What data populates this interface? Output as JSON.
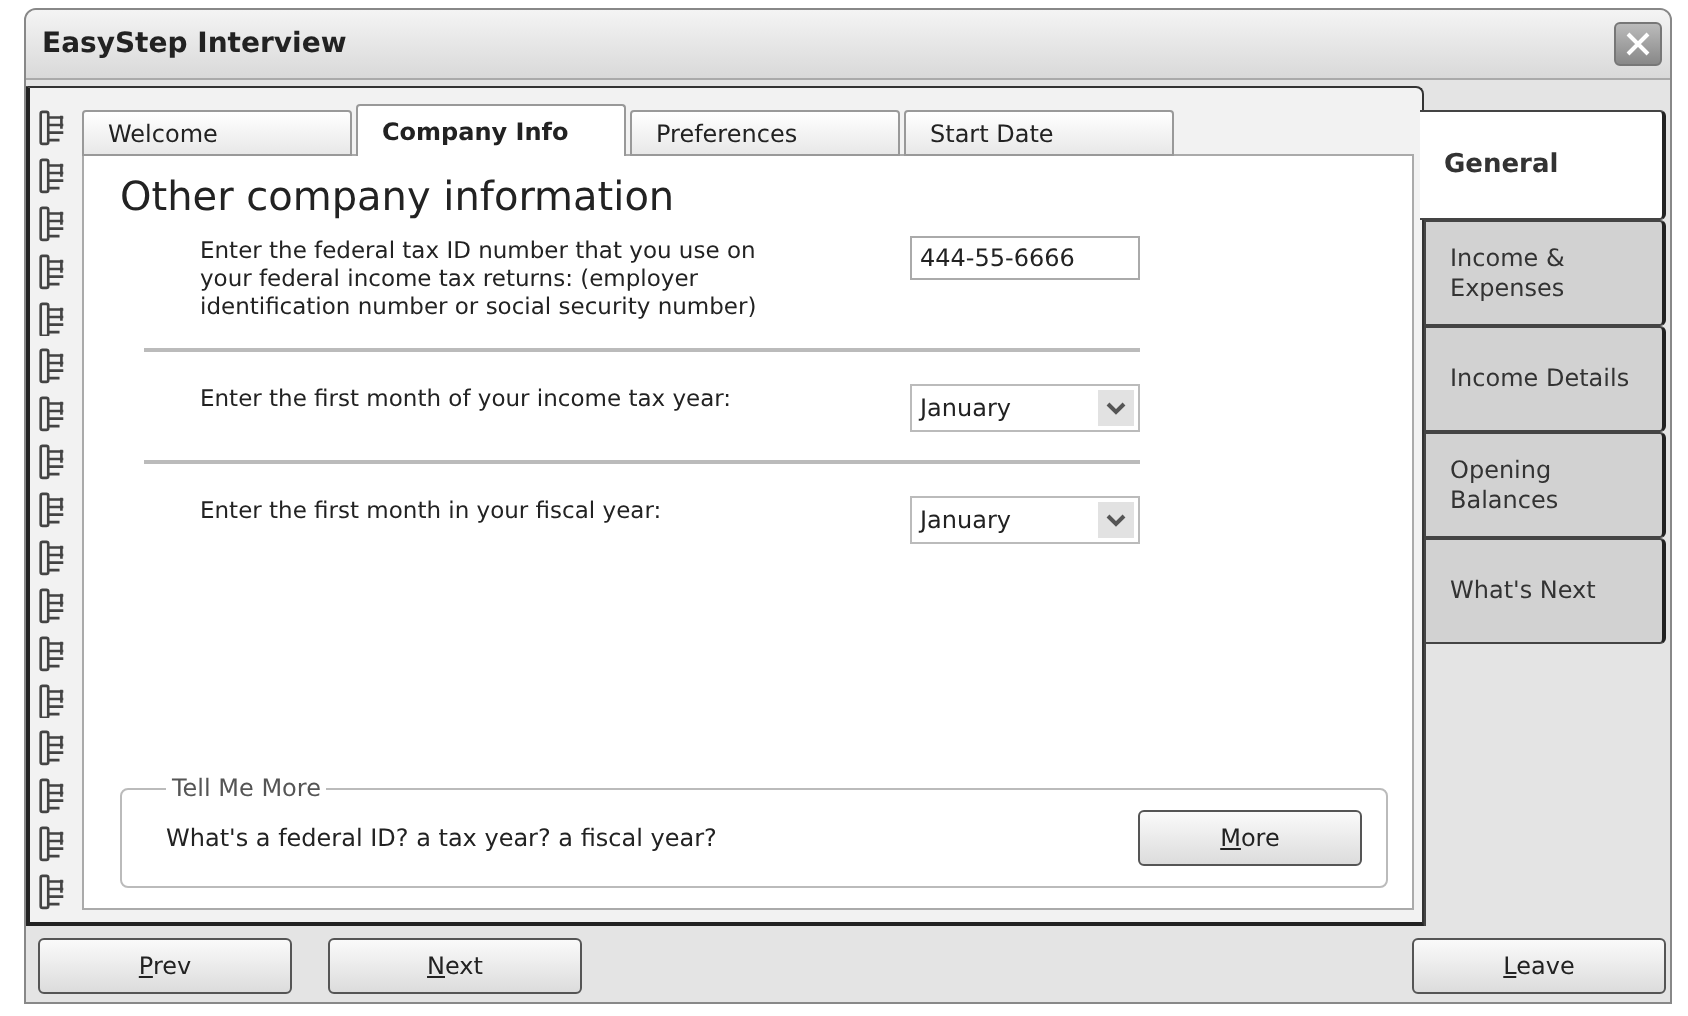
{
  "window": {
    "title": "EasyStep Interview"
  },
  "tabs": [
    {
      "label": "Welcome",
      "selected": false
    },
    {
      "label": "Company Info",
      "selected": true
    },
    {
      "label": "Preferences",
      "selected": false
    },
    {
      "label": "Start Date",
      "selected": false
    }
  ],
  "sections": [
    {
      "label": "General",
      "selected": true
    },
    {
      "label": "Income & Expenses",
      "selected": false
    },
    {
      "label": "Income Details",
      "selected": false
    },
    {
      "label": "Opening Balances",
      "selected": false
    },
    {
      "label": "What's Next",
      "selected": false
    }
  ],
  "page": {
    "heading": "Other company information",
    "questions": [
      {
        "kind": "text",
        "prompt": "Enter the federal tax ID number that you use on your federal income tax returns: (employer identification number or social security number)",
        "value": "444-55-6666"
      },
      {
        "kind": "dropdown",
        "prompt": "Enter the first month of your income tax year:",
        "value": "January"
      },
      {
        "kind": "dropdown",
        "prompt": "Enter the first month in your fiscal year:",
        "value": "January"
      }
    ]
  },
  "tell_me_more": {
    "legend": "Tell Me More",
    "text": "What's a federal ID? a tax year? a fiscal year?",
    "button": {
      "label": "More",
      "mnemonic_underlined": true
    }
  },
  "buttons": [
    {
      "label": "Prev",
      "mnemonic_underlined": true
    },
    {
      "label": "Next",
      "mnemonic_underlined": true
    },
    {
      "label": "Leave",
      "mnemonic_underlined": true
    }
  ]
}
